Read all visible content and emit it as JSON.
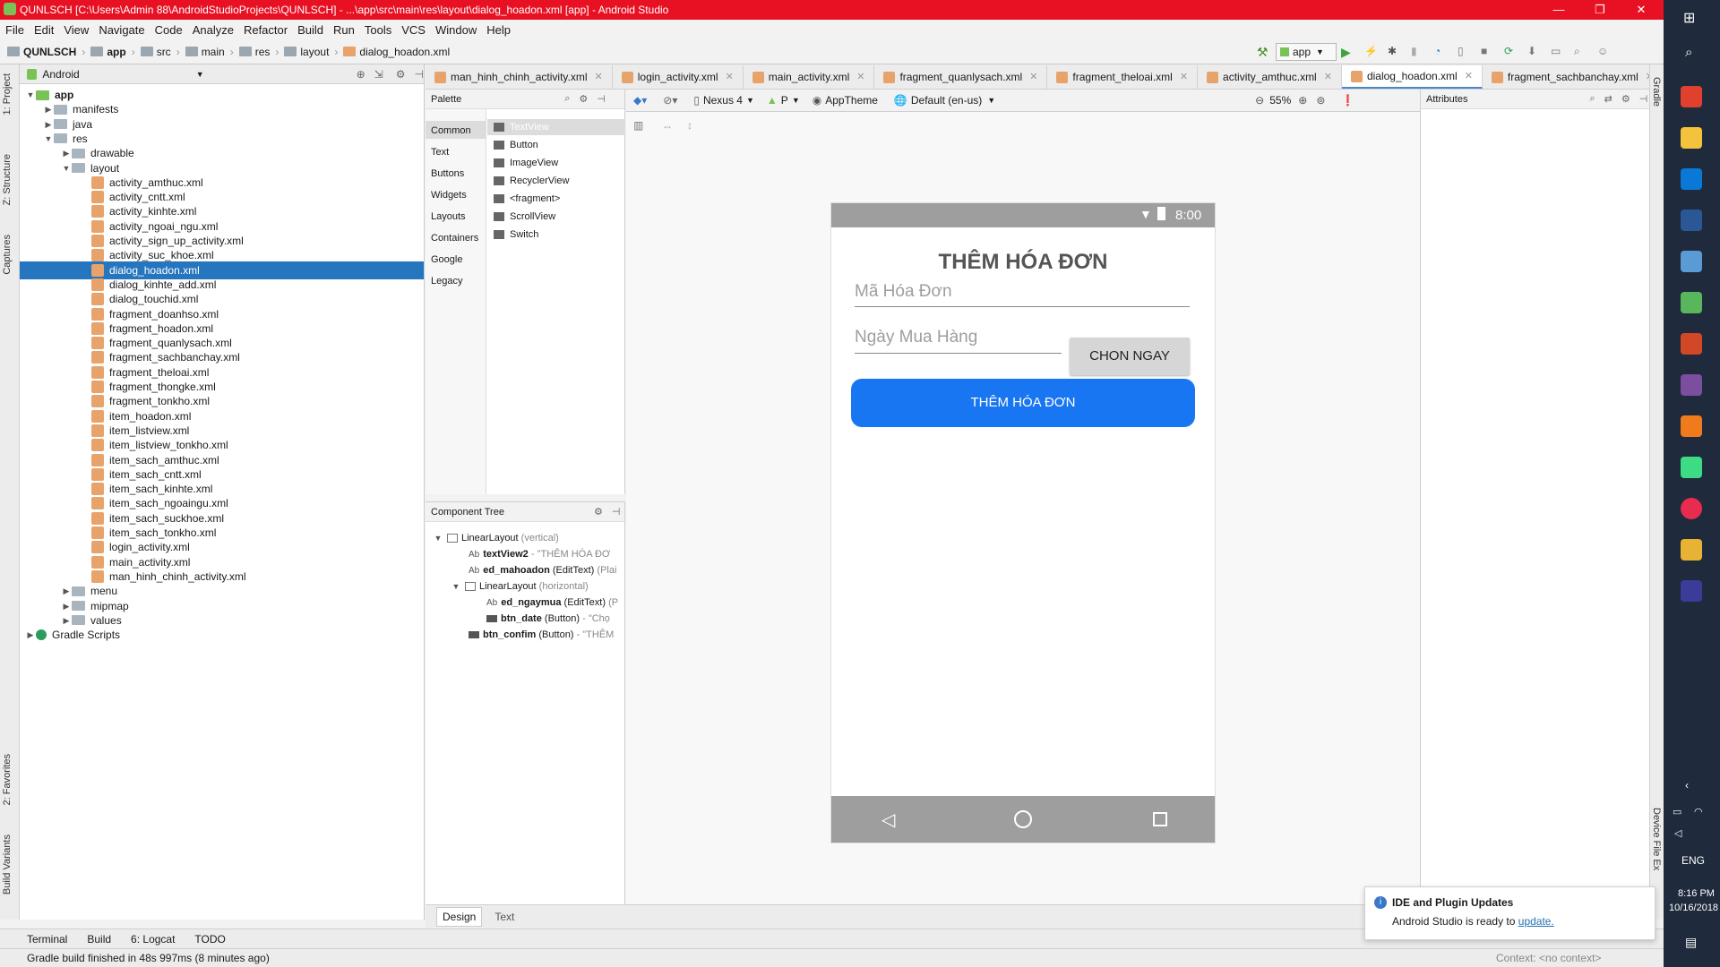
{
  "window": {
    "title": "QUNLSCH [C:\\Users\\Admin 88\\AndroidStudioProjects\\QUNLSCH] - ...\\app\\src\\main\\res\\layout\\dialog_hoadon.xml [app] - Android Studio",
    "minimize": "—",
    "maximize": "❐",
    "close": "✕"
  },
  "menu": [
    "File",
    "Edit",
    "View",
    "Navigate",
    "Code",
    "Analyze",
    "Refactor",
    "Build",
    "Run",
    "Tools",
    "VCS",
    "Window",
    "Help"
  ],
  "breadcrumbs": [
    "QUNLSCH",
    "app",
    "src",
    "main",
    "res",
    "layout",
    "dialog_hoadon.xml"
  ],
  "run_config": "app",
  "project_panel": {
    "view_mode": "Android",
    "tree": [
      {
        "label": "app",
        "depth": 0,
        "type": "module",
        "expanded": true
      },
      {
        "label": "manifests",
        "depth": 1,
        "type": "folder",
        "expanded": false
      },
      {
        "label": "java",
        "depth": 1,
        "type": "folder",
        "expanded": false
      },
      {
        "label": "res",
        "depth": 1,
        "type": "folder",
        "expanded": true
      },
      {
        "label": "drawable",
        "depth": 2,
        "type": "folder",
        "expanded": false
      },
      {
        "label": "layout",
        "depth": 2,
        "type": "folder",
        "expanded": true
      },
      {
        "label": "activity_amthuc.xml",
        "depth": 3,
        "type": "xml"
      },
      {
        "label": "activity_cntt.xml",
        "depth": 3,
        "type": "xml"
      },
      {
        "label": "activity_kinhte.xml",
        "depth": 3,
        "type": "xml"
      },
      {
        "label": "activity_ngoai_ngu.xml",
        "depth": 3,
        "type": "xml"
      },
      {
        "label": "activity_sign_up_activity.xml",
        "depth": 3,
        "type": "xml"
      },
      {
        "label": "activity_suc_khoe.xml",
        "depth": 3,
        "type": "xml"
      },
      {
        "label": "dialog_hoadon.xml",
        "depth": 3,
        "type": "xml",
        "selected": true
      },
      {
        "label": "dialog_kinhte_add.xml",
        "depth": 3,
        "type": "xml"
      },
      {
        "label": "dialog_touchid.xml",
        "depth": 3,
        "type": "xml"
      },
      {
        "label": "fragment_doanhso.xml",
        "depth": 3,
        "type": "xml"
      },
      {
        "label": "fragment_hoadon.xml",
        "depth": 3,
        "type": "xml"
      },
      {
        "label": "fragment_quanlysach.xml",
        "depth": 3,
        "type": "xml"
      },
      {
        "label": "fragment_sachbanchay.xml",
        "depth": 3,
        "type": "xml"
      },
      {
        "label": "fragment_theloai.xml",
        "depth": 3,
        "type": "xml"
      },
      {
        "label": "fragment_thongke.xml",
        "depth": 3,
        "type": "xml"
      },
      {
        "label": "fragment_tonkho.xml",
        "depth": 3,
        "type": "xml"
      },
      {
        "label": "item_hoadon.xml",
        "depth": 3,
        "type": "xml"
      },
      {
        "label": "item_listview.xml",
        "depth": 3,
        "type": "xml"
      },
      {
        "label": "item_listview_tonkho.xml",
        "depth": 3,
        "type": "xml"
      },
      {
        "label": "item_sach_amthuc.xml",
        "depth": 3,
        "type": "xml"
      },
      {
        "label": "item_sach_cntt.xml",
        "depth": 3,
        "type": "xml"
      },
      {
        "label": "item_sach_kinhte.xml",
        "depth": 3,
        "type": "xml"
      },
      {
        "label": "item_sach_ngoaingu.xml",
        "depth": 3,
        "type": "xml"
      },
      {
        "label": "item_sach_suckhoe.xml",
        "depth": 3,
        "type": "xml"
      },
      {
        "label": "item_sach_tonkho.xml",
        "depth": 3,
        "type": "xml"
      },
      {
        "label": "login_activity.xml",
        "depth": 3,
        "type": "xml"
      },
      {
        "label": "main_activity.xml",
        "depth": 3,
        "type": "xml"
      },
      {
        "label": "man_hinh_chinh_activity.xml",
        "depth": 3,
        "type": "xml"
      },
      {
        "label": "menu",
        "depth": 2,
        "type": "folder",
        "expanded": false
      },
      {
        "label": "mipmap",
        "depth": 2,
        "type": "folder",
        "expanded": false
      },
      {
        "label": "values",
        "depth": 2,
        "type": "folder",
        "expanded": false
      },
      {
        "label": "Gradle Scripts",
        "depth": 0,
        "type": "gradle",
        "expanded": false
      }
    ]
  },
  "left_tool_tabs": [
    "1: Project",
    "Z: Structure",
    "Captures",
    "2: Favorites",
    "Build Variants"
  ],
  "right_tool_tabs": [
    "Gradle",
    "Device File Ex"
  ],
  "editor_tabs": [
    {
      "label": "man_hinh_chinh_activity.xml",
      "active": false
    },
    {
      "label": "login_activity.xml",
      "active": false
    },
    {
      "label": "main_activity.xml",
      "active": false
    },
    {
      "label": "fragment_quanlysach.xml",
      "active": false
    },
    {
      "label": "fragment_theloai.xml",
      "active": false
    },
    {
      "label": "activity_amthuc.xml",
      "active": false
    },
    {
      "label": "dialog_hoadon.xml",
      "active": true
    },
    {
      "label": "fragment_sachbanchay.xml",
      "active": false
    }
  ],
  "palette": {
    "title": "Palette",
    "categories": [
      "Common",
      "Text",
      "Buttons",
      "Widgets",
      "Layouts",
      "Containers",
      "Google",
      "Legacy"
    ],
    "items": [
      "TextView",
      "Button",
      "ImageView",
      "RecyclerView",
      "<fragment>",
      "ScrollView",
      "Switch"
    ]
  },
  "design_toolbar": {
    "device": "Nexus 4",
    "api": "P",
    "theme": "AppTheme",
    "locale": "Default (en-us)",
    "zoom": "55%"
  },
  "component_tree": {
    "title": "Component Tree",
    "rows": [
      {
        "name": "LinearLayout",
        "extra": "(vertical)",
        "depth": 0
      },
      {
        "name": "textView2",
        "extra": "- \"THÊM HÓA ĐƠ",
        "depth": 1
      },
      {
        "name": "ed_mahoadon",
        "type": "(EditText)",
        "extra": "(Plai",
        "depth": 1
      },
      {
        "name": "LinearLayout",
        "extra": "(horizontal)",
        "depth": 1
      },
      {
        "name": "ed_ngaymua",
        "type": "(EditText)",
        "extra": "(P",
        "depth": 2
      },
      {
        "name": "btn_date",
        "type": "(Button)",
        "extra": "- \"Chọ",
        "depth": 2
      },
      {
        "name": "btn_confim",
        "type": "(Button)",
        "extra": "- \"THÊM",
        "depth": 1
      }
    ]
  },
  "phone_preview": {
    "time": "8:00",
    "heading": "THÊM HÓA ĐƠN",
    "invoice_hint": "Mã Hóa Đơn",
    "date_hint": "Ngày Mua Hàng",
    "pick_date": "CHON NGAY",
    "confirm": "THÊM HÓA ĐƠN",
    "accent": "#1976f2"
  },
  "attributes": {
    "title": "Attributes"
  },
  "design_tabs": [
    "Design",
    "Text"
  ],
  "bottom_tabs": [
    "Terminal",
    "Build",
    "6: Logcat",
    "TODO"
  ],
  "status": {
    "message": "Gradle build finished in 48s 997ms (8 minutes ago)",
    "context": "Context: <no context>"
  },
  "notification": {
    "title": "IDE and Plugin Updates",
    "body": "Android Studio is ready to",
    "link": "update."
  },
  "taskbar": {
    "time": "8:16 PM",
    "date": "10/16/2018",
    "lang": "ENG"
  }
}
